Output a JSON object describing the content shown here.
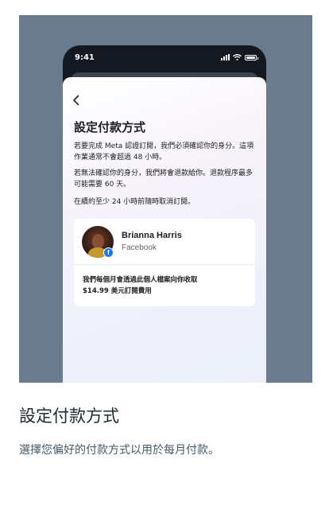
{
  "phone": {
    "status_time": "9:41",
    "icons": [
      "signal-icon",
      "wifi-icon",
      "battery-icon"
    ]
  },
  "screen": {
    "back_icon": "chevron-left-icon",
    "title": "設定付款方式",
    "paragraph1": "若要完成 Meta 認證訂閱，我們必須確認你的身分。這項作業通常不會超過 48 小時。",
    "paragraph2": "若無法確認你的身分，我們將會退款給你。退款程序最多可能需要 60 天。",
    "paragraph3": "在續約至少 24 小時前隨時取消訂閱。",
    "account": {
      "name": "Brianna Harris",
      "platform": "Facebook",
      "badge_icon": "facebook-icon"
    },
    "charge_line1": "我們每個月會透過此個人檔案向你收取",
    "charge_line2": "$14.99 美元訂閱費用"
  },
  "caption": {
    "title": "設定付款方式",
    "description": "選擇您偏好的付款方式以用於每月付款。"
  },
  "colors": {
    "hero_background": "#6b7b8e",
    "facebook_blue": "#1877f2"
  }
}
